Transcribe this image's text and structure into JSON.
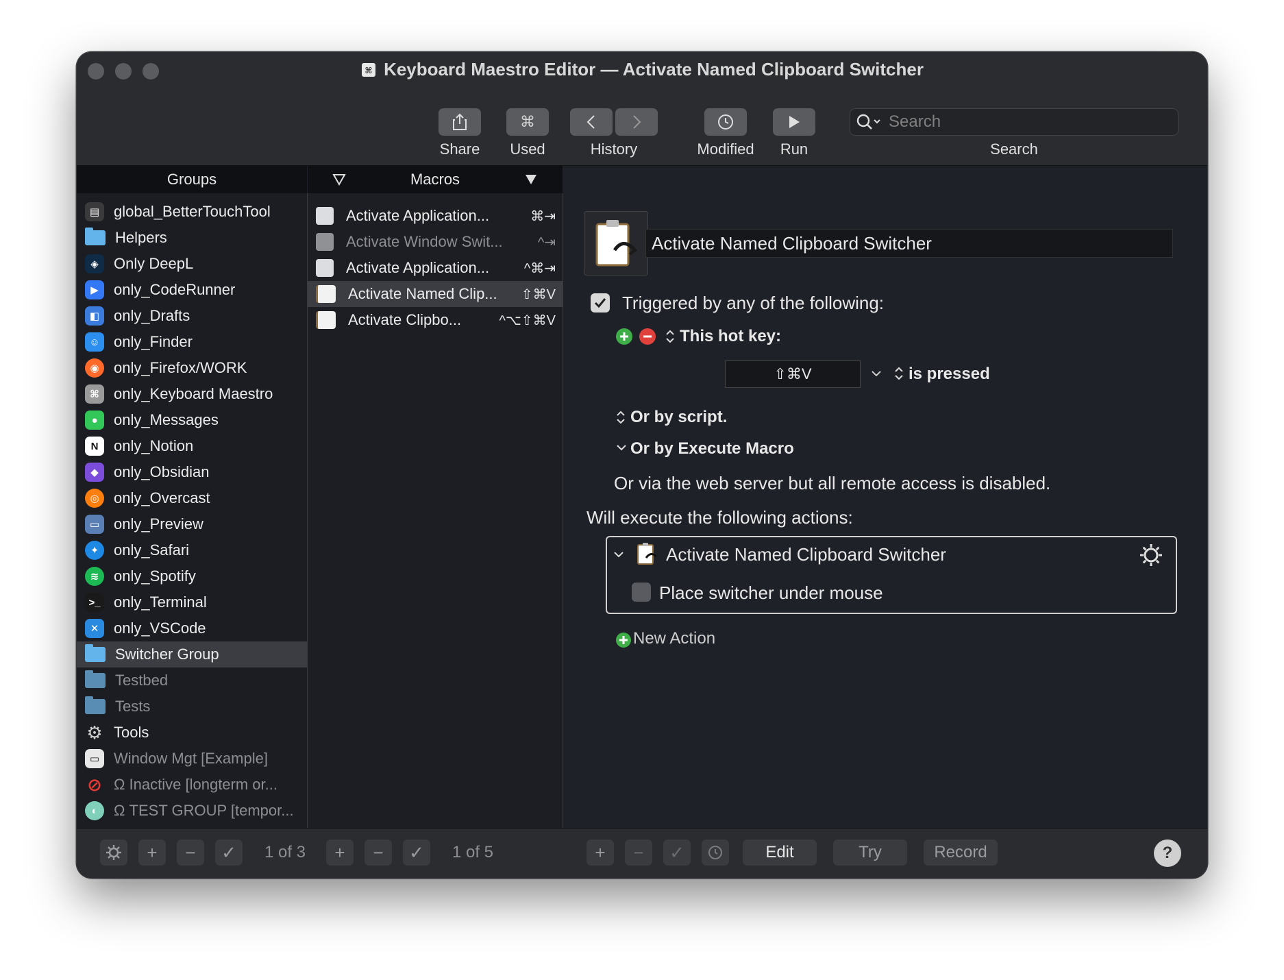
{
  "window": {
    "title": "Keyboard Maestro Editor — Activate Named Clipboard Switcher"
  },
  "toolbar": {
    "share_label": "Share",
    "used_label": "Used",
    "history_label": "History",
    "modified_label": "Modified",
    "run_label": "Run",
    "search_label": "Search",
    "search_placeholder": "Search"
  },
  "groups": {
    "header": "Groups",
    "items": [
      {
        "label": "global_BetterTouchTool",
        "icon": "bettertouchtool-icon",
        "color": "#3a3a3c"
      },
      {
        "label": "Helpers",
        "icon": "folder-icon",
        "color": "#63b4ea"
      },
      {
        "label": "Only DeepL",
        "icon": "deepl-icon",
        "color": "#0f2b46"
      },
      {
        "label": "only_CodeRunner",
        "icon": "coderunner-icon",
        "color": "#3478f6"
      },
      {
        "label": "only_Drafts",
        "icon": "drafts-icon",
        "color": "#3b7bdc"
      },
      {
        "label": "only_Finder",
        "icon": "finder-icon",
        "color": "#2c8ff0"
      },
      {
        "label": "only_Firefox/WORK",
        "icon": "firefox-icon",
        "color": "#ff6a2a"
      },
      {
        "label": "only_Keyboard Maestro",
        "icon": "keyboard-maestro-icon",
        "color": "#9a9a9a"
      },
      {
        "label": "only_Messages",
        "icon": "messages-icon",
        "color": "#33c759"
      },
      {
        "label": "only_Notion",
        "icon": "notion-icon",
        "color": "#ffffff"
      },
      {
        "label": "only_Obsidian",
        "icon": "obsidian-icon",
        "color": "#7c4ddb"
      },
      {
        "label": "only_Overcast",
        "icon": "overcast-icon",
        "color": "#fc7e0f"
      },
      {
        "label": "only_Preview",
        "icon": "preview-icon",
        "color": "#5a7fb5"
      },
      {
        "label": "only_Safari",
        "icon": "safari-icon",
        "color": "#1e88e5"
      },
      {
        "label": "only_Spotify",
        "icon": "spotify-icon",
        "color": "#1db954"
      },
      {
        "label": "only_Terminal",
        "icon": "terminal-icon",
        "color": "#1a1a1a"
      },
      {
        "label": "only_VSCode",
        "icon": "vscode-icon",
        "color": "#2a8ae0"
      },
      {
        "label": "Switcher Group",
        "icon": "folder-icon",
        "color": "#63b4ea",
        "selected": true
      },
      {
        "label": "Testbed",
        "icon": "folder-icon",
        "color": "#5a8db4",
        "dim": true
      },
      {
        "label": "Tests",
        "icon": "folder-icon",
        "color": "#5a8db4",
        "dim": true
      },
      {
        "label": "Tools",
        "icon": "gear-icon",
        "color": "#d0d0d0"
      },
      {
        "label": "Window Mgt [Example]",
        "icon": "window-icon",
        "color": "#e8e8e8",
        "dim": true
      },
      {
        "label": "Ω Inactive [longterm or...",
        "icon": "prohibited-icon",
        "color": "#e53935",
        "dim": true
      },
      {
        "label": "Ω TEST GROUP [tempor...",
        "icon": "test-group-icon",
        "color": "#7fcfb9",
        "dim": true
      }
    ]
  },
  "macros": {
    "header": "Macros",
    "items": [
      {
        "label": "Activate Application...",
        "shortcut": "⌘⇥"
      },
      {
        "label": "Activate Window Swit...",
        "shortcut": "^⇥",
        "dim": true
      },
      {
        "label": "Activate Application...",
        "shortcut": "^⌘⇥"
      },
      {
        "label": "Activate Named Clip...",
        "shortcut": "⇧⌘V",
        "selected": true
      },
      {
        "label": "Activate Clipbo...",
        "shortcut": "^⌥⇧⌘V"
      }
    ]
  },
  "detail": {
    "macro_name": "Activate Named Clipboard Switcher",
    "triggered_label": "Triggered by any of the following:",
    "hotkey_label": "This hot key:",
    "hotkey_value": "⇧⌘V",
    "is_pressed_label": "is pressed",
    "or_script_label": "Or by script.",
    "or_execute_label": "Or by Execute Macro",
    "web_server_text": "Or via the web server but all remote access is disabled.",
    "will_execute_label": "Will execute the following actions:",
    "action_title": "Activate Named Clipboard Switcher",
    "action_option_label": "Place switcher under mouse",
    "new_action_label": "New Action"
  },
  "bottombar": {
    "groups_count": "1 of 3",
    "macros_count": "1 of 5",
    "edit_label": "Edit",
    "try_label": "Try",
    "record_label": "Record",
    "help_label": "?"
  }
}
